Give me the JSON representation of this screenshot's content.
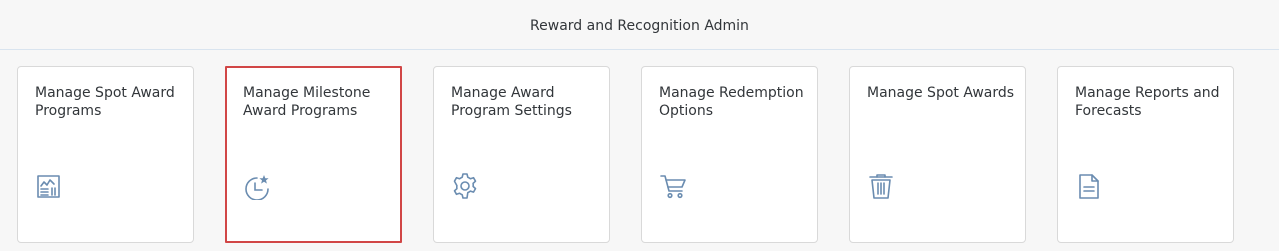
{
  "header": {
    "title": "Reward and Recognition Admin"
  },
  "colors": {
    "icon": "#6a8cb0",
    "selected_border": "#d14646",
    "text": "#32363a"
  },
  "tiles": [
    {
      "title": "Manage Spot Award Programs",
      "icon": "report-icon",
      "selected": false
    },
    {
      "title": "Manage Milestone Award Programs",
      "icon": "milestone-icon",
      "selected": true
    },
    {
      "title": "Manage Award Program Settings",
      "icon": "gear-icon",
      "selected": false
    },
    {
      "title": "Manage Redemption Options",
      "icon": "cart-icon",
      "selected": false
    },
    {
      "title": "Manage Spot Awards",
      "icon": "trash-icon",
      "selected": false
    },
    {
      "title": "Manage Reports and Forecasts",
      "icon": "document-icon",
      "selected": false
    }
  ]
}
